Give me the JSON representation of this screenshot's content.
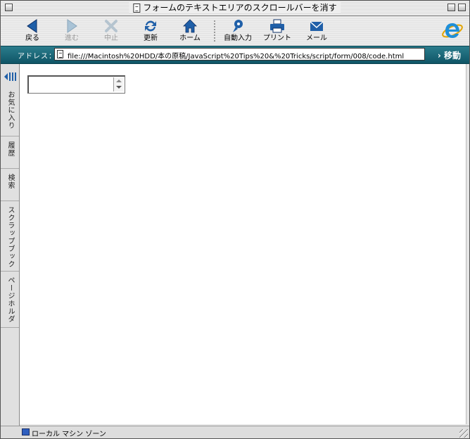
{
  "window": {
    "title": "フォームのテキストエリアのスクロールバーを消す"
  },
  "toolbar": {
    "back_label": "戻る",
    "forward_label": "進む",
    "stop_label": "中止",
    "refresh_label": "更新",
    "home_label": "ホーム",
    "autofill_label": "自動入力",
    "print_label": "プリント",
    "mail_label": "メール"
  },
  "address": {
    "label": "アドレス：",
    "url": "file:///Macintosh%20HDD/本の原稿/JavaScript%20Tips%20&%20Tricks/script/form/008/code.html",
    "go_label": "移動"
  },
  "sidebar": {
    "tabs": [
      {
        "label": "お気に入り"
      },
      {
        "label": "履歴"
      },
      {
        "label": "検索"
      },
      {
        "label": "スクラップブック"
      },
      {
        "label": "ページホルダ"
      }
    ]
  },
  "status": {
    "zone_text": "ローカル マシン ゾーン"
  },
  "colors": {
    "address_bar": "#1b6c7c",
    "toolbar_icon_blue": "#1f5fa8"
  }
}
